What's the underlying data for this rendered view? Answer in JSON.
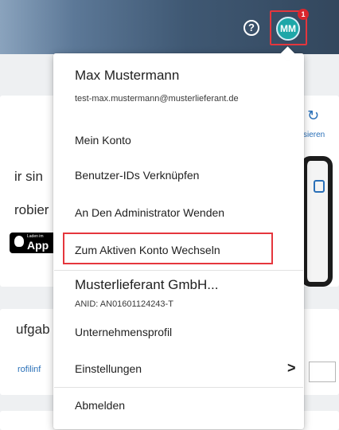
{
  "topbar": {
    "help_icon": "?",
    "avatar_initials": "MM",
    "notification_count": "1"
  },
  "background": {
    "line1": "ir sin",
    "line2": "robier",
    "appstore_small": "Laden im",
    "appstore_big": "App",
    "line3": "ufgab",
    "link_text": "rofilinf",
    "sieren_text": "sieren"
  },
  "user_menu": {
    "name": "Max Mustermann",
    "email": "test-max.mustermann@musterlieferant.de",
    "items": [
      "Mein Konto",
      "Benutzer-IDs Verknüpfen",
      "An Den Administrator Wenden",
      "Zum Aktiven Konto Wechseln"
    ],
    "company": "Musterlieferant GmbH...",
    "anid": "ANID: AN01601124243-T",
    "company_profile": "Unternehmensprofil",
    "settings": "Einstellungen",
    "settings_chevron": ">",
    "logout": "Abmelden"
  },
  "colors": {
    "highlight": "#e5363d",
    "avatar": "#1ea7a8",
    "badge": "#d9262d",
    "link": "#2a70b8"
  }
}
